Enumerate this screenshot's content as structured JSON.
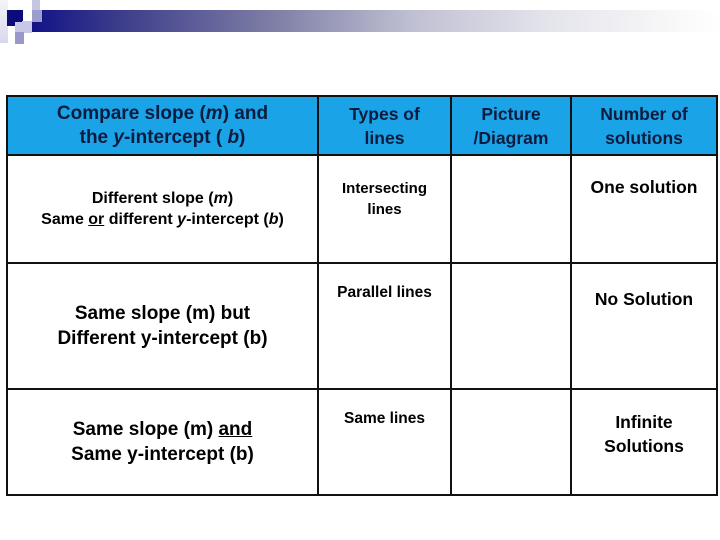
{
  "slide": {
    "accent_colors": {
      "header_bg": "#1aa3e6",
      "header_text": "#0d1b3e",
      "title_bar_start": "#131388",
      "title_bar_end": "#ffffff"
    },
    "table": {
      "headers": {
        "compare": {
          "line1_a": "Compare slope (",
          "line1_m": "m",
          "line1_b": ") and",
          "line2_a": "the ",
          "line2_y": "y",
          "line2_b": "-intercept ( ",
          "line2_bvar": "b",
          "line2_c": ")"
        },
        "types": {
          "line1": "Types of",
          "line2": "lines"
        },
        "picture": {
          "line1": "Picture",
          "line2": "/Diagram"
        },
        "number": {
          "line1": "Number of",
          "line2": "solutions"
        }
      },
      "rows": [
        {
          "compare": {
            "line1_a": "Different slope (",
            "line1_m": "m",
            "line1_b": ")",
            "line2_a": "Same ",
            "line2_or": "or",
            "line2_b": " different ",
            "line2_y": "y",
            "line2_c": "-intercept (",
            "line2_bvar": "b",
            "line2_d": ")"
          },
          "type": {
            "line1": "Intersecting",
            "line2": "lines"
          },
          "picture": "",
          "solutions": "One solution"
        },
        {
          "compare": {
            "line1": "Same slope (m) but",
            "line2": "Different y-intercept (b)"
          },
          "type": "Parallel lines",
          "picture": "",
          "solutions": "No Solution"
        },
        {
          "compare": {
            "line1_a": "Same slope (m) ",
            "line1_and": "and",
            "line2": "Same y-intercept (b)"
          },
          "type": "Same lines",
          "picture": "",
          "solutions": {
            "line1": "Infinite",
            "line2": "Solutions"
          }
        }
      ]
    }
  }
}
